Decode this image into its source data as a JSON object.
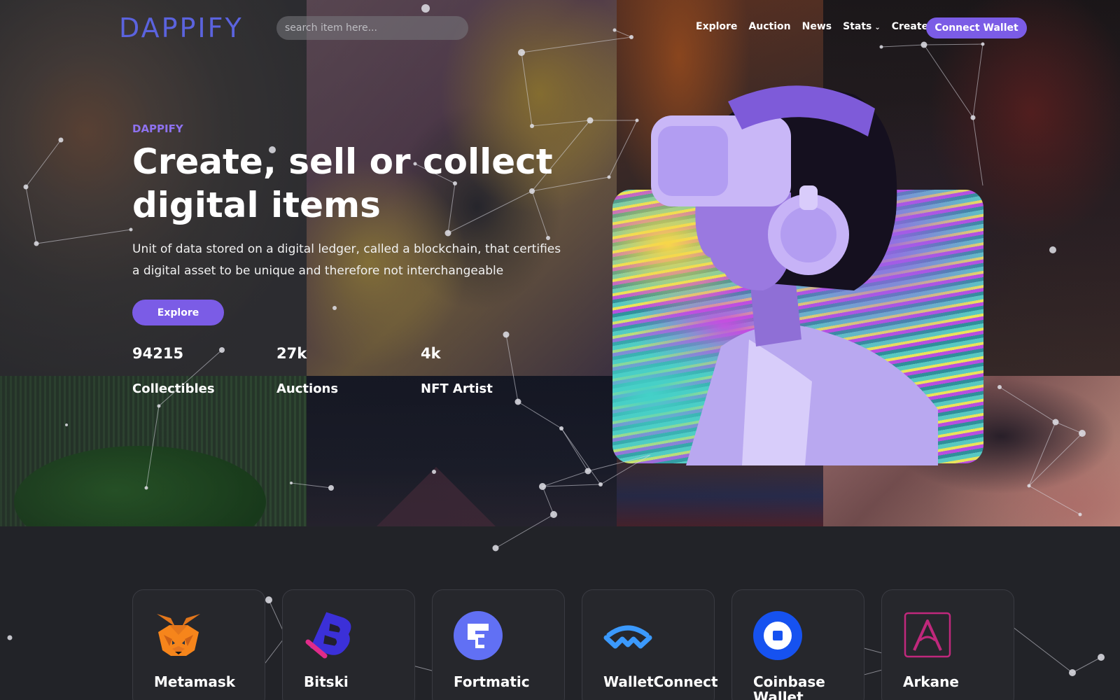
{
  "nav": {
    "logo": "DAPPIFY",
    "search_placeholder": "search item here...",
    "menu": [
      "Explore",
      "Auction",
      "News",
      "Stats",
      "Create"
    ],
    "connect_label": "Connect Wallet"
  },
  "hero": {
    "eyebrow": "DAPPIFY",
    "title": "Create, sell or collect digital items",
    "subtitle": "Unit of data stored on a digital ledger, called a blockchain, that certifies a digital asset to be unique and therefore not interchangeable",
    "cta": "Explore",
    "stats": [
      {
        "value": "94215",
        "label": "Collectibles"
      },
      {
        "value": "27k",
        "label": "Auctions"
      },
      {
        "value": "4k",
        "label": "NFT Artist"
      }
    ]
  },
  "wallets": [
    {
      "name": "Metamask",
      "icon": "metamask-fox-icon"
    },
    {
      "name": "Bitski",
      "icon": "bitski-icon"
    },
    {
      "name": "Fortmatic",
      "icon": "fortmatic-icon"
    },
    {
      "name": "WalletConnect",
      "icon": "walletconnect-icon"
    },
    {
      "name": "Coinbase Wallet",
      "icon": "coinbase-icon"
    },
    {
      "name": "Arkane",
      "icon": "arkane-icon"
    }
  ],
  "colors": {
    "accent": "#7b5ce6",
    "logo": "#5b63de",
    "background": "#222328",
    "card": "#26272c"
  }
}
